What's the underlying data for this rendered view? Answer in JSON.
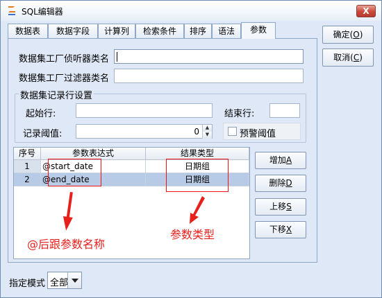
{
  "window": {
    "title": "SQL编辑器",
    "close_label": "X"
  },
  "tabs": [
    {
      "label": "数据表"
    },
    {
      "label": "数据字段"
    },
    {
      "label": "计算列"
    },
    {
      "label": "检索条件"
    },
    {
      "label": "排序"
    },
    {
      "label": "语法"
    },
    {
      "label": "参数"
    }
  ],
  "active_tab": "参数",
  "form": {
    "listener_label": "数据集工厂侦听器类名",
    "listener_value": "",
    "filter_label": "数据集工厂过滤器类名",
    "filter_value": ""
  },
  "record_group": {
    "title": "数据集记录行设置",
    "start_label": "起始行:",
    "start_value": "",
    "end_label": "结束行:",
    "end_value": "",
    "threshold_label": "记录阈值:",
    "threshold_value": "0",
    "warn_label": "预警阈值",
    "warn_checked": false
  },
  "table": {
    "headers": [
      "序号",
      "参数表达式",
      "结果类型"
    ],
    "rows": [
      {
        "no": "1",
        "expr": "@start_date",
        "type": "日期组"
      },
      {
        "no": "2",
        "expr": "@end_date",
        "type": "日期组"
      }
    ],
    "selected_row": 2
  },
  "side_buttons": {
    "add": {
      "label": "增加",
      "key": "A"
    },
    "delete": {
      "label": "删除",
      "key": "D"
    },
    "up": {
      "label": "上移",
      "key": "S"
    },
    "down": {
      "label": "下移",
      "key": "X"
    }
  },
  "dialog_buttons": {
    "ok": {
      "label": "确定",
      "key": "O"
    },
    "cancel": {
      "label": "取消",
      "key": "C"
    }
  },
  "annotations": {
    "param_name": "@后跟参数名称",
    "param_type": "参数类型"
  },
  "footer": {
    "mode_label": "指定模式",
    "mode_value": "全部"
  },
  "colors": {
    "accent": "#e8201c",
    "window_bg": "#dfe8f6",
    "selection": "#b8cbe6"
  }
}
